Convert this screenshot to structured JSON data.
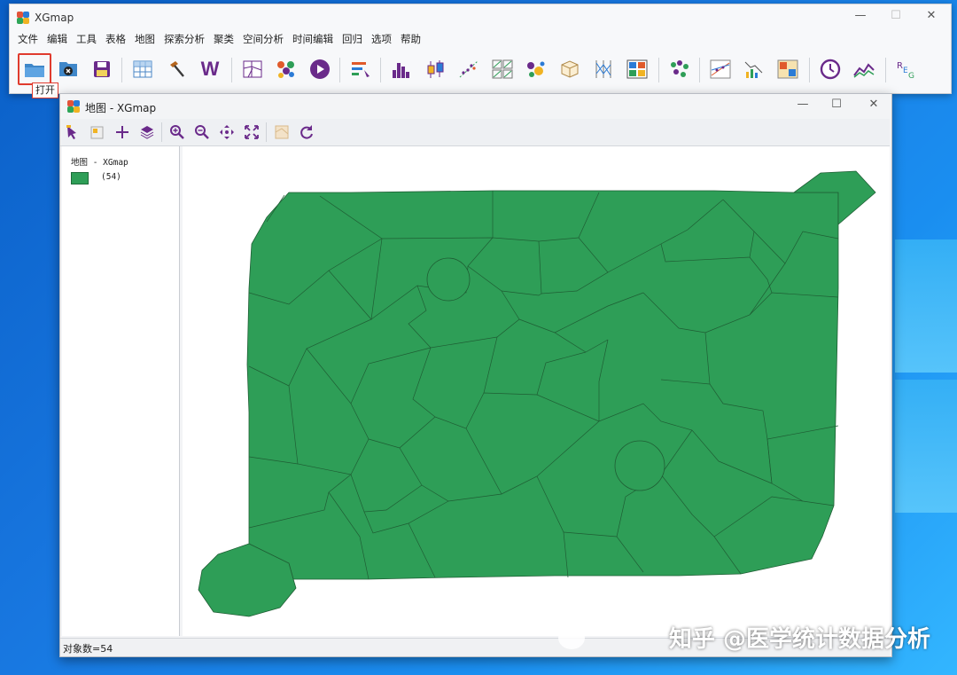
{
  "app": {
    "title": "XGmap",
    "menu": [
      "文件",
      "编辑",
      "工具",
      "表格",
      "地图",
      "探索分析",
      "聚类",
      "空间分析",
      "时间编辑",
      "回归",
      "选项",
      "帮助"
    ],
    "window_controls": [
      "—",
      "☐",
      "✕"
    ],
    "toolbar_icons": [
      "open-folder-icon",
      "close-file-icon",
      "save-icon",
      "table-icon",
      "hammer-tool-icon",
      "weights-w-icon",
      "map-grid-icon",
      "cluster-dots-icon",
      "play-icon",
      "sort-bars-icon",
      "histogram-icon",
      "boxplot-icon",
      "scatter-icon",
      "scatter-matrix-icon",
      "bubble-chart-icon",
      "3d-scatter-icon",
      "parallel-coords-icon",
      "conditional-map-icon",
      "cluster-map-icon",
      "scatter-compare-icon",
      "correlogram-icon",
      "averages-chart-icon",
      "time-clock-icon",
      "line-chart-icon",
      "regression-icon"
    ],
    "tooltip": "打开"
  },
  "map_window": {
    "title": "地图 - XGmap",
    "tools": [
      "select-arrow-icon",
      "select-layer-icon",
      "add-icon",
      "layers-icon",
      "zoom-in-icon",
      "zoom-out-icon",
      "pan-icon",
      "full-extent-icon",
      "disabled-map-icon",
      "refresh-icon"
    ],
    "legend": {
      "title": "地图 - XGmap",
      "items": [
        {
          "label": "(54)",
          "color": "#2e9e57"
        }
      ]
    },
    "map_fill": "#2e9e57",
    "status": "对象数=54"
  },
  "watermark": "知乎 @医学统计数据分析"
}
